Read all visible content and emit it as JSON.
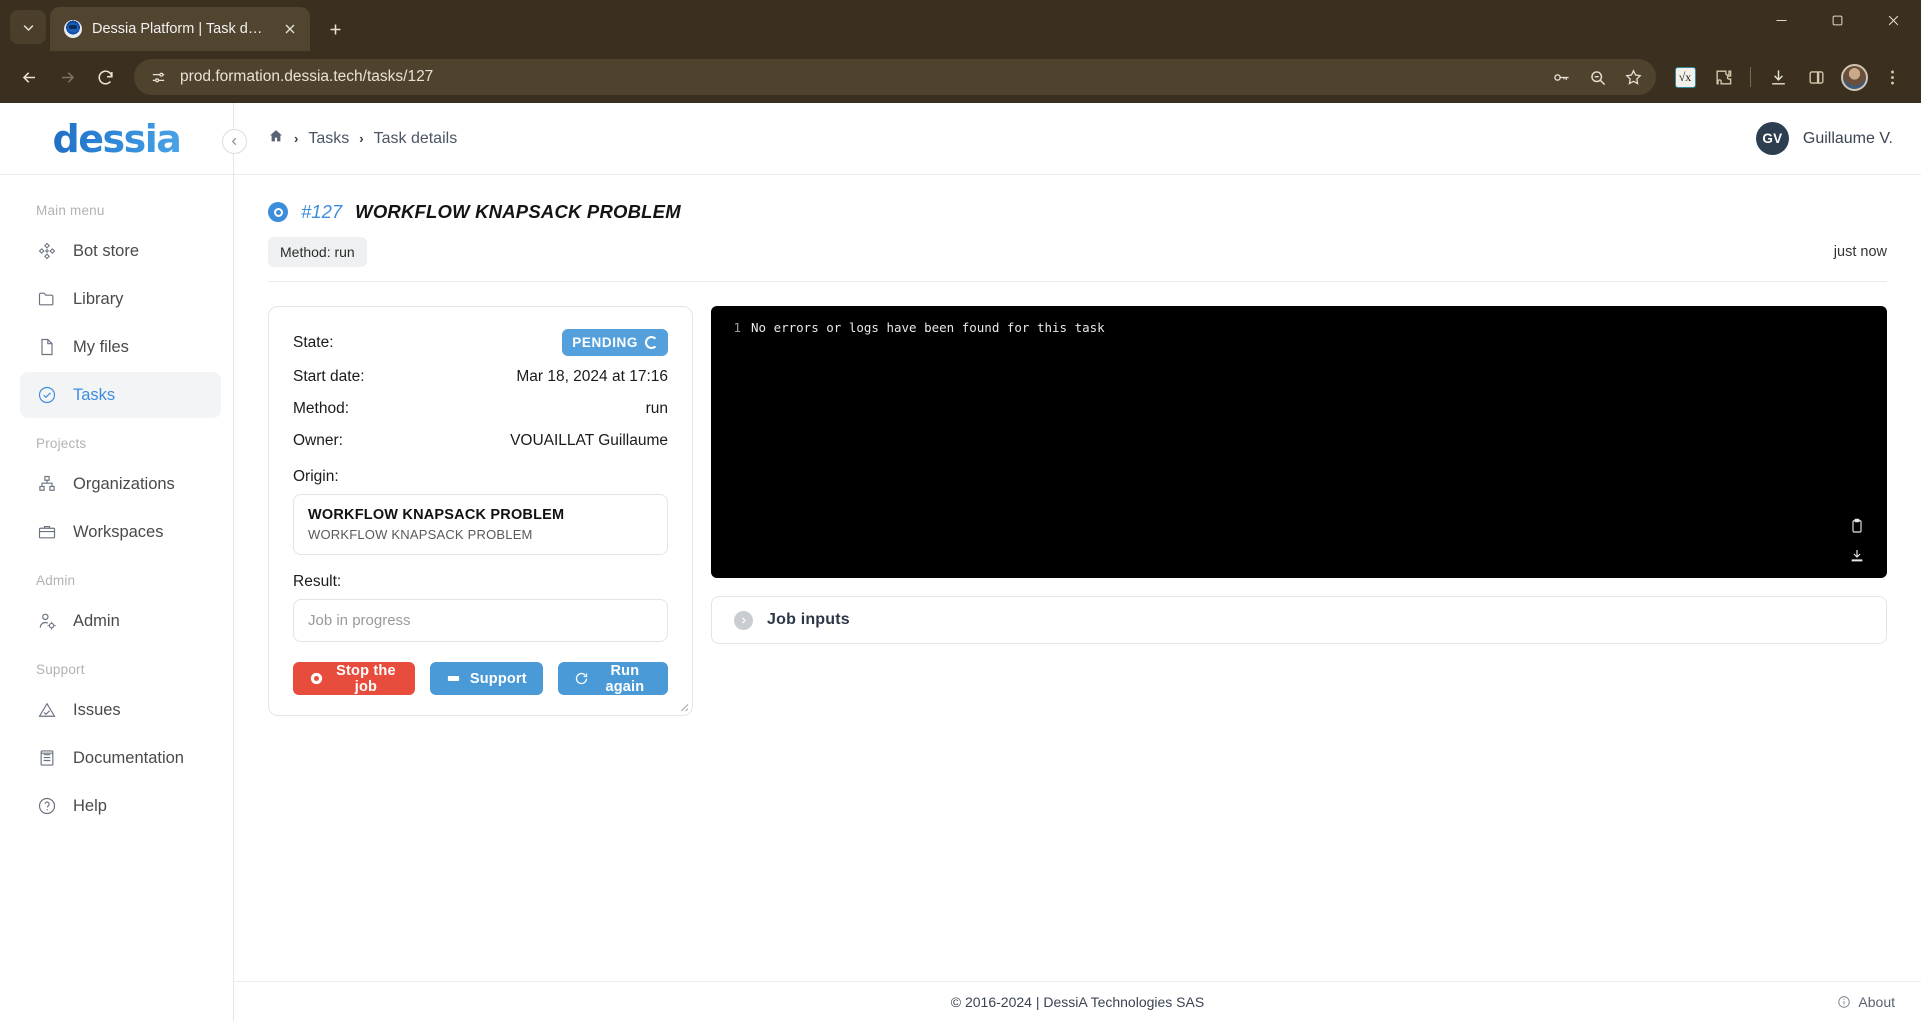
{
  "browser": {
    "tab": {
      "title": "Dessia Platform | Task details",
      "favicon": "dessia-favicon"
    },
    "new_tab_label": "+",
    "url": "prod.formation.dessia.tech/tasks/127",
    "toolbar_icons": [
      "password-key-icon",
      "zoom-search-icon",
      "bookmark-star-icon",
      "math-extension-icon",
      "extensions-puzzle-icon",
      "download-icon",
      "side-panel-icon",
      "profile-avatar-icon",
      "chrome-menu-icon"
    ],
    "nav": {
      "back": "back-arrow",
      "forward": "forward-arrow",
      "reload": "reload-arrow"
    },
    "window": {
      "minimize": "minimize",
      "maximize": "maximize",
      "close": "close"
    }
  },
  "sidebar": {
    "logo": "dessia",
    "collapse_icon": "chevron-left-icon",
    "sections": [
      {
        "label": "Main menu",
        "items": [
          {
            "label": "Bot store",
            "icon": "bot-store-icon",
            "active": false
          },
          {
            "label": "Library",
            "icon": "folder-icon",
            "active": false
          },
          {
            "label": "My files",
            "icon": "file-icon",
            "active": false
          },
          {
            "label": "Tasks",
            "icon": "check-circle-icon",
            "active": true
          }
        ]
      },
      {
        "label": "Projects",
        "items": [
          {
            "label": "Organizations",
            "icon": "org-chart-icon",
            "active": false
          },
          {
            "label": "Workspaces",
            "icon": "briefcase-icon",
            "active": false
          }
        ]
      },
      {
        "label": "Admin",
        "items": [
          {
            "label": "Admin",
            "icon": "user-gear-icon",
            "active": false
          }
        ]
      },
      {
        "label": "Support",
        "items": [
          {
            "label": "Issues",
            "icon": "warning-triangle-icon",
            "active": false
          },
          {
            "label": "Documentation",
            "icon": "document-list-icon",
            "active": false
          },
          {
            "label": "Help",
            "icon": "question-circle-icon",
            "active": false
          }
        ]
      }
    ]
  },
  "topbar": {
    "breadcrumb": {
      "home_icon": "home-icon",
      "items": [
        "Tasks",
        "Task details"
      ],
      "separator": "›"
    },
    "user": {
      "initials": "GV",
      "name": "Guillaume V."
    }
  },
  "task": {
    "status_icon": "pending-circle-icon",
    "id": "#127",
    "name": "WORKFLOW KNAPSACK PROBLEM",
    "method_chip": "Method: run",
    "updated": "just now"
  },
  "info": {
    "state_label": "State:",
    "state_value": "PENDING",
    "start_label": "Start date:",
    "start_value": "Mar 18, 2024 at 17:16",
    "method_label": "Method:",
    "method_value": "run",
    "owner_label": "Owner:",
    "owner_value": "VOUAILLAT Guillaume",
    "origin_label": "Origin:",
    "origin_title": "WORKFLOW KNAPSACK PROBLEM",
    "origin_subtitle": "WORKFLOW KNAPSACK PROBLEM",
    "result_label": "Result:",
    "result_placeholder": "Job in progress",
    "buttons": {
      "stop": "Stop the job",
      "support": "Support",
      "run_again": "Run again"
    },
    "colors": {
      "danger": "#e74c3c",
      "primary": "#4a9ad8",
      "badge": "#54a0dc"
    }
  },
  "console": {
    "line_number": "1",
    "text": "No errors or logs have been found for this task",
    "copy_icon": "clipboard-icon",
    "download_icon": "download-icon"
  },
  "job_inputs": {
    "title": "Job inputs",
    "expand_icon": "chevron-right-circle-icon"
  },
  "footer": {
    "copyright": "© 2016-2024 | DessiA Technologies SAS",
    "about": "About",
    "about_icon": "info-circle-icon"
  }
}
